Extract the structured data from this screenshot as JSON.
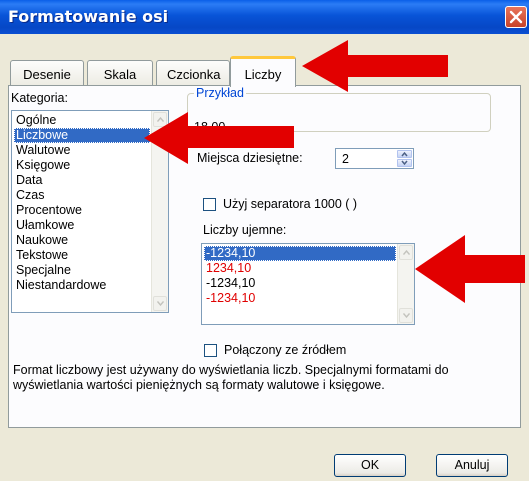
{
  "window": {
    "title": "Formatowanie osi"
  },
  "tabs": [
    {
      "label": "Desenie"
    },
    {
      "label": "Skala"
    },
    {
      "label": "Czcionka"
    },
    {
      "label": "Liczby"
    }
  ],
  "category": {
    "label": "Kategoria:",
    "items": [
      "Ogólne",
      "Liczbowe",
      "Walutowe",
      "Księgowe",
      "Data",
      "Czas",
      "Procentowe",
      "Ułamkowe",
      "Naukowe",
      "Tekstowe",
      "Specjalne",
      "Niestandardowe"
    ],
    "selected": "Liczbowe"
  },
  "preview": {
    "legend": "Przykład",
    "value": "18,00"
  },
  "decimals": {
    "label": "Miejsca dziesiętne:",
    "value": "2"
  },
  "separator": {
    "label": "Użyj separatora 1000 ( )",
    "checked": false
  },
  "negative": {
    "label": "Liczby ujemne:",
    "items": [
      {
        "text": "-1234,10",
        "color": "#000000"
      },
      {
        "text": "1234,10",
        "color": "#e00000"
      },
      {
        "text": "-1234,10",
        "color": "#000000"
      },
      {
        "text": "-1234,10",
        "color": "#e00000"
      }
    ],
    "selected": "-1234,10"
  },
  "linked": {
    "label": "Połączony ze źródłem",
    "checked": false
  },
  "description": "Format liczbowy jest używany do wyświetlania liczb. Specjalnymi formatami do wyświetlania wartości pieniężnych są formaty walutowe i księgowe.",
  "buttons": {
    "ok": "OK",
    "cancel": "Anuluj"
  },
  "annotation_color": "#e20000"
}
